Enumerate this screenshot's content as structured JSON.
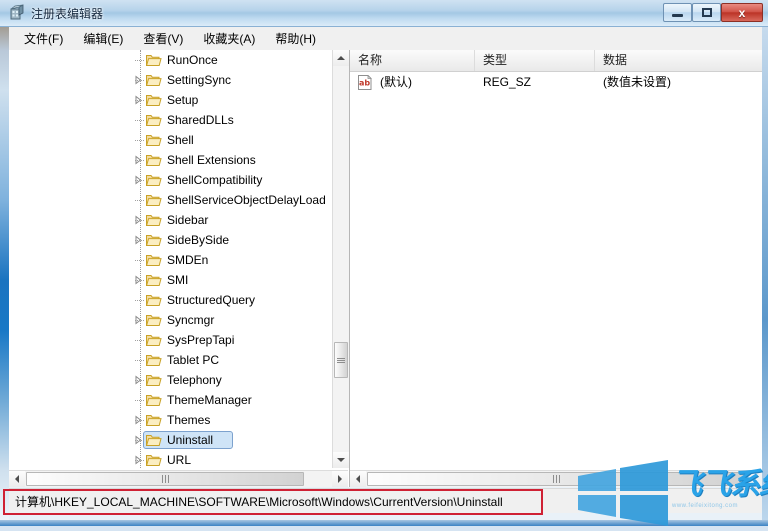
{
  "window": {
    "title": "注册表编辑器",
    "icon": "registry-editor-icon",
    "controls": {
      "minimize": "minimize-button",
      "maximize": "maximize-button",
      "close_label": "x"
    }
  },
  "menubar": {
    "items": [
      {
        "label": "文件(F)",
        "name": "menu-file"
      },
      {
        "label": "编辑(E)",
        "name": "menu-edit"
      },
      {
        "label": "查看(V)",
        "name": "menu-view"
      },
      {
        "label": "收藏夹(A)",
        "name": "menu-favorites"
      },
      {
        "label": "帮助(H)",
        "name": "menu-help"
      }
    ]
  },
  "tree": {
    "items": [
      {
        "label": "RunOnce",
        "expandable": false,
        "selected": false
      },
      {
        "label": "SettingSync",
        "expandable": true,
        "selected": false
      },
      {
        "label": "Setup",
        "expandable": true,
        "selected": false
      },
      {
        "label": "SharedDLLs",
        "expandable": false,
        "selected": false
      },
      {
        "label": "Shell",
        "expandable": false,
        "selected": false
      },
      {
        "label": "Shell Extensions",
        "expandable": true,
        "selected": false
      },
      {
        "label": "ShellCompatibility",
        "expandable": true,
        "selected": false
      },
      {
        "label": "ShellServiceObjectDelayLoad",
        "expandable": false,
        "selected": false
      },
      {
        "label": "Sidebar",
        "expandable": true,
        "selected": false
      },
      {
        "label": "SideBySide",
        "expandable": true,
        "selected": false
      },
      {
        "label": "SMDEn",
        "expandable": false,
        "selected": false
      },
      {
        "label": "SMI",
        "expandable": true,
        "selected": false
      },
      {
        "label": "StructuredQuery",
        "expandable": false,
        "selected": false
      },
      {
        "label": "Syncmgr",
        "expandable": true,
        "selected": false
      },
      {
        "label": "SysPrepTapi",
        "expandable": false,
        "selected": false
      },
      {
        "label": "Tablet PC",
        "expandable": false,
        "selected": false
      },
      {
        "label": "Telephony",
        "expandable": true,
        "selected": false
      },
      {
        "label": "ThemeManager",
        "expandable": false,
        "selected": false
      },
      {
        "label": "Themes",
        "expandable": true,
        "selected": false
      },
      {
        "label": "Uninstall",
        "expandable": true,
        "selected": true
      },
      {
        "label": "URL",
        "expandable": true,
        "selected": false
      }
    ]
  },
  "values": {
    "columns": [
      "名称",
      "类型",
      "数据"
    ],
    "rows": [
      {
        "name": "(默认)",
        "type": "REG_SZ",
        "data": "(数值未设置)",
        "icon": "string-value-icon"
      }
    ]
  },
  "statusbar": {
    "path": "计算机\\HKEY_LOCAL_MACHINE\\SOFTWARE\\Microsoft\\Windows\\CurrentVersion\\Uninstall"
  },
  "watermark": {
    "brand": "飞飞系统",
    "url": "www.feifeixitong.com"
  },
  "colors": {
    "annotation": "#cf2134",
    "selection": "#cfe4f7",
    "titlebar_accent": "#a3c8e4",
    "brand_blue": "#2aa3e8"
  }
}
